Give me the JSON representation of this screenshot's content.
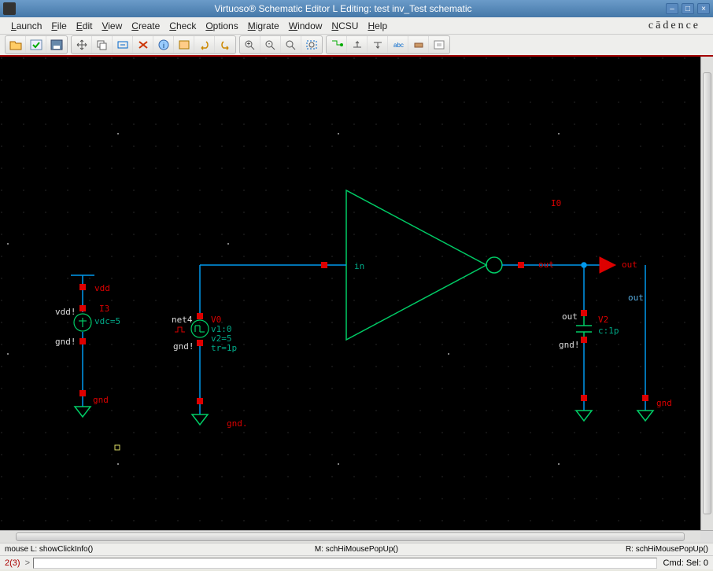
{
  "title": "Virtuoso® Schematic Editor L Editing: test inv_Test schematic",
  "brand": "cādence",
  "menus": [
    "Launch",
    "File",
    "Edit",
    "View",
    "Create",
    "Check",
    "Options",
    "Migrate",
    "Window",
    "NCSU",
    "Help"
  ],
  "toolbar_groups": [
    [
      "open-icon",
      "check-save-icon",
      "save-icon"
    ],
    [
      "move-icon",
      "copy-icon",
      "stretch-icon",
      "delete-icon",
      "info-icon",
      "query-icon",
      "undo-icon",
      "redo-icon"
    ],
    [
      "zoom-in-icon",
      "zoom-out-icon",
      "zoom-fit-icon",
      "zoom-area-icon"
    ],
    [
      "descend-icon",
      "return-up-icon",
      "return-down-icon",
      "label-icon",
      "wire-icon",
      "pin-icon"
    ]
  ],
  "schematic": {
    "instance_label": "I0",
    "inverter": {
      "in_label": "in",
      "out_label": "out",
      "out_net_label": "out"
    },
    "vdd_source": {
      "name": "I3",
      "top_net": "vdd",
      "vdd_bang": "vdd!",
      "gnd_bang": "gnd!",
      "param": "vdc=5",
      "gnd_label": "gnd"
    },
    "pulse_source": {
      "name": "V0",
      "net": "net4",
      "gnd_bang": "gnd!",
      "params": [
        "v1:0",
        "v2=5",
        "tr=1p"
      ],
      "gnd_label": "gnd."
    },
    "cap": {
      "name": "V2",
      "out_label": "out",
      "param": "c:1p",
      "gnd_bang": "gnd!",
      "gnd_label": "gnd"
    },
    "pin_out": "out"
  },
  "status": {
    "mouse_l": "mouse L: showClickInfo()",
    "mouse_m": "M: schHiMousePopUp()",
    "mouse_r": "R: schHiMousePopUp()",
    "err_count": "2(3)",
    "prompt": ">",
    "cmd_sel": "Cmd: Sel: 0"
  },
  "window_controls": {
    "min": "–",
    "max": "□",
    "close": "×"
  }
}
